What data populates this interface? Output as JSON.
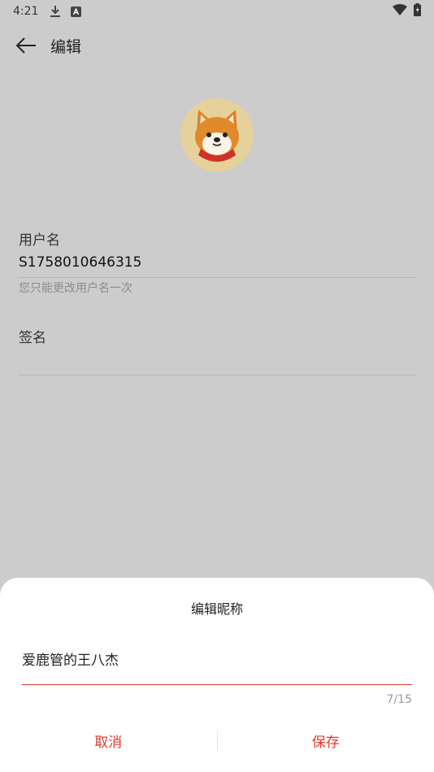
{
  "status_bar": {
    "time": "4:21"
  },
  "header": {
    "title": "编辑"
  },
  "profile": {
    "username_label": "用户名",
    "username_value": "S1758010646315",
    "username_hint": "您只能更改用户名一次",
    "signature_label": "签名"
  },
  "dialog": {
    "title": "编辑昵称",
    "nickname_value": "爱鹿管的王八杰",
    "counter": "7/15",
    "cancel_label": "取消",
    "save_label": "保存",
    "accent_color": "#e33a2f"
  }
}
